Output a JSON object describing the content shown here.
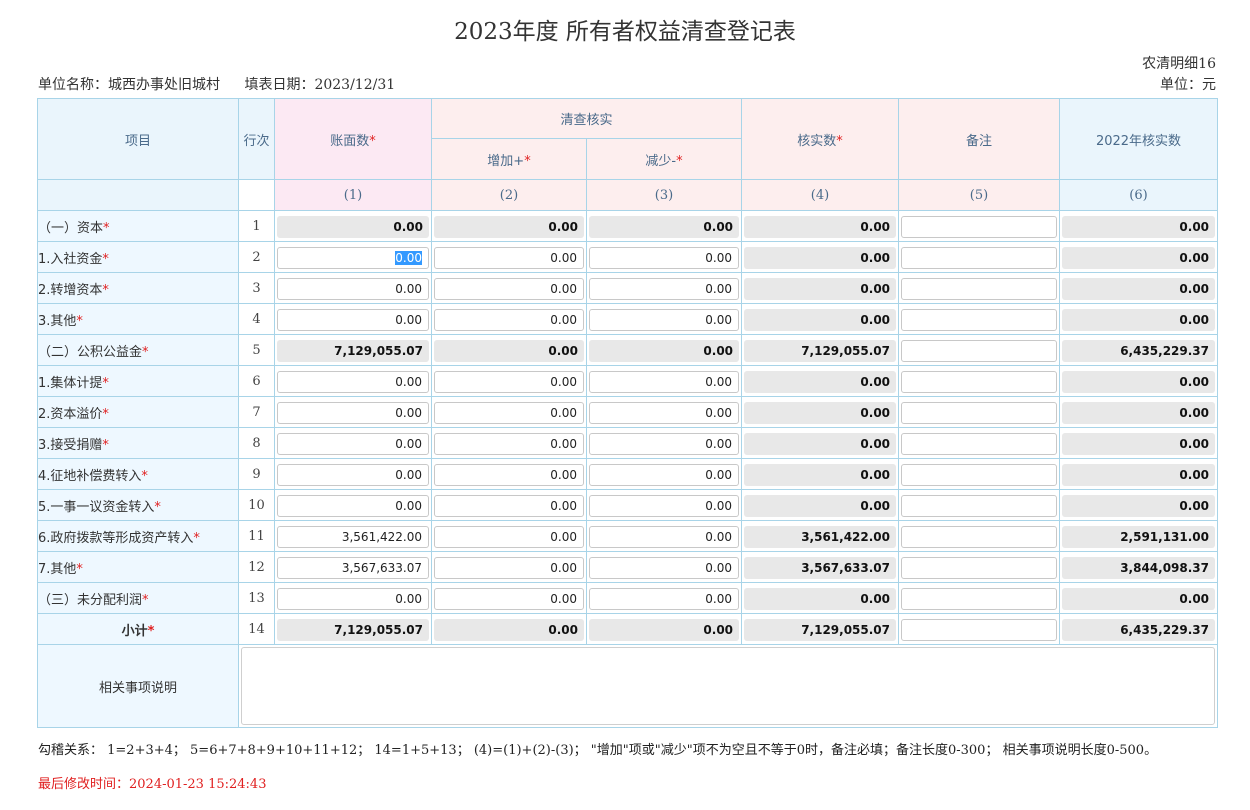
{
  "title": "2023年度 所有者权益清查登记表",
  "form_code": "农清明细16",
  "unit_name_label": "单位名称：城西办事处旧城村",
  "fill_date_label": "填表日期：2023/12/31",
  "unit_label": "单位：元",
  "headers": {
    "item": "项目",
    "row_no": "行次",
    "book": "账面数",
    "audit_group": "清查核实",
    "increase": "增加+",
    "decrease": "减少-",
    "verified": "核实数",
    "note": "备注",
    "prev_verified": "2022年核实数",
    "star": "*"
  },
  "col_numbers": [
    "(1)",
    "(2)",
    "(3)",
    "(4)",
    "(5)",
    "(6)"
  ],
  "rows": [
    {
      "label": "（一）资本",
      "no": "1",
      "book": "0.00",
      "inc": "0.00",
      "dec": "0.00",
      "verified": "0.00",
      "prev": "0.00"
    },
    {
      "label": "1.入社资金",
      "no": "2",
      "book": "0.00",
      "inc": "0.00",
      "dec": "0.00",
      "verified": "0.00",
      "prev": "0.00"
    },
    {
      "label": "2.转增资本",
      "no": "3",
      "book": "0.00",
      "inc": "0.00",
      "dec": "0.00",
      "verified": "0.00",
      "prev": "0.00"
    },
    {
      "label": "3.其他",
      "no": "4",
      "book": "0.00",
      "inc": "0.00",
      "dec": "0.00",
      "verified": "0.00",
      "prev": "0.00"
    },
    {
      "label": "（二）公积公益金",
      "no": "5",
      "book": "7,129,055.07",
      "inc": "0.00",
      "dec": "0.00",
      "verified": "7,129,055.07",
      "prev": "6,435,229.37"
    },
    {
      "label": "1.集体计提",
      "no": "6",
      "book": "0.00",
      "inc": "0.00",
      "dec": "0.00",
      "verified": "0.00",
      "prev": "0.00"
    },
    {
      "label": "2.资本溢价",
      "no": "7",
      "book": "0.00",
      "inc": "0.00",
      "dec": "0.00",
      "verified": "0.00",
      "prev": "0.00"
    },
    {
      "label": "3.接受捐赠",
      "no": "8",
      "book": "0.00",
      "inc": "0.00",
      "dec": "0.00",
      "verified": "0.00",
      "prev": "0.00"
    },
    {
      "label": "4.征地补偿费转入",
      "no": "9",
      "book": "0.00",
      "inc": "0.00",
      "dec": "0.00",
      "verified": "0.00",
      "prev": "0.00"
    },
    {
      "label": "5.一事一议资金转入",
      "no": "10",
      "book": "0.00",
      "inc": "0.00",
      "dec": "0.00",
      "verified": "0.00",
      "prev": "0.00"
    },
    {
      "label": "6.政府拨款等形成资产转入",
      "no": "11",
      "book": "3,561,422.00",
      "inc": "0.00",
      "dec": "0.00",
      "verified": "3,561,422.00",
      "prev": "2,591,131.00"
    },
    {
      "label": "7.其他",
      "no": "12",
      "book": "3,567,633.07",
      "inc": "0.00",
      "dec": "0.00",
      "verified": "3,567,633.07",
      "prev": "3,844,098.37"
    },
    {
      "label": "（三）未分配利润",
      "no": "13",
      "book": "0.00",
      "inc": "0.00",
      "dec": "0.00",
      "verified": "0.00",
      "prev": "0.00"
    },
    {
      "label": "小计",
      "no": "14",
      "book": "7,129,055.07",
      "inc": "0.00",
      "dec": "0.00",
      "verified": "7,129,055.07",
      "prev": "6,435,229.37"
    }
  ],
  "description_label": "相关事项说明",
  "formula_text": "勾稽关系： 1=2+3+4； 5=6+7+8+9+10+11+12； 14=1+5+13； (4)=(1)+(2)-(3)； \"增加\"项或\"减少\"项不为空且不等于0时，备注必填；备注长度0-300； 相关事项说明长度0-500。",
  "last_modified": "最后修改时间：2024-01-23 15:24:43"
}
